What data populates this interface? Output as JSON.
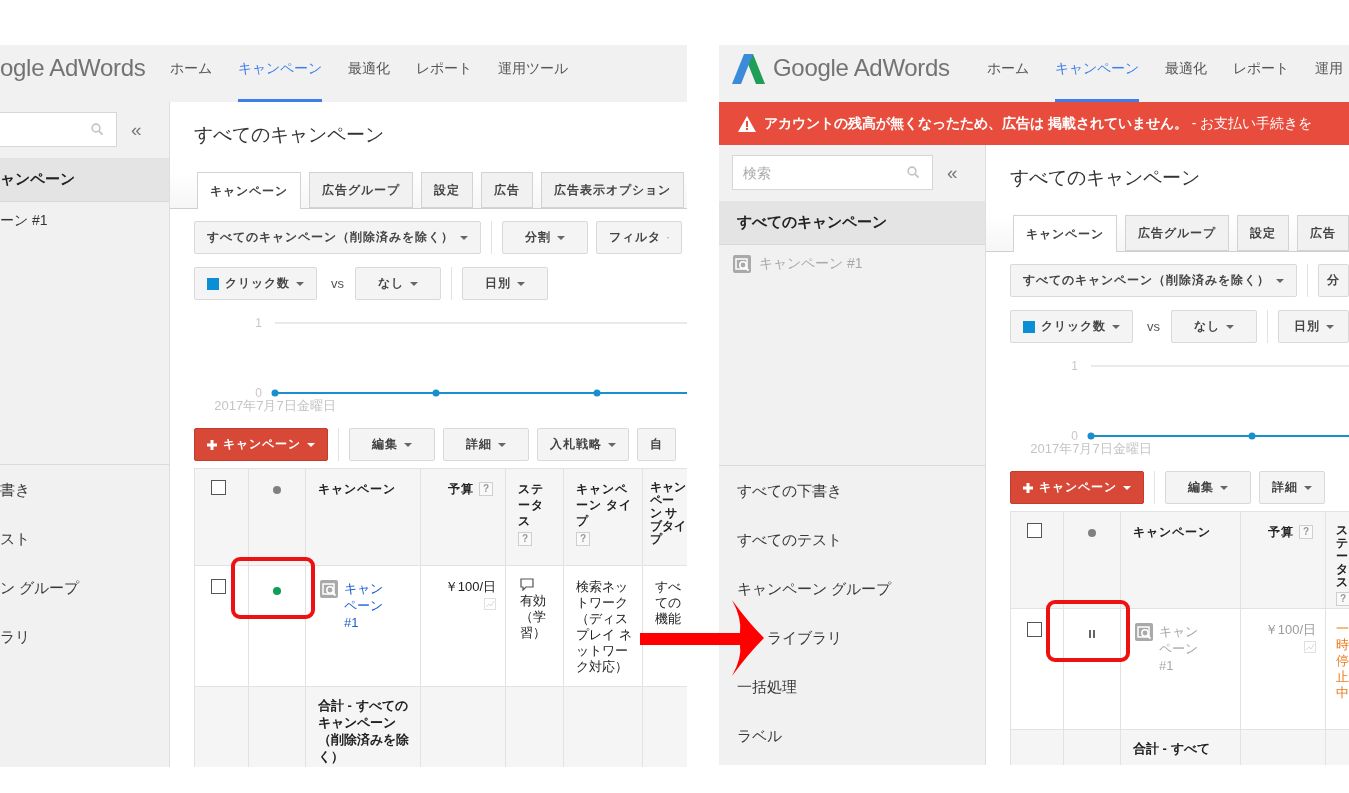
{
  "screens": [
    {
      "header": {
        "logo": "ogle AdWords",
        "nav": [
          {
            "label": "ホーム",
            "selected": false
          },
          {
            "label": "キャンペーン",
            "selected": true
          },
          {
            "label": "最適化",
            "selected": false
          },
          {
            "label": "レポート",
            "selected": false
          },
          {
            "label": "運用ツール",
            "selected": false
          }
        ]
      },
      "sidebar": {
        "collapse": "«",
        "views": [
          {
            "label": "ャンペーン",
            "selected": true
          }
        ],
        "campaigns": [
          {
            "label": "ーン #1",
            "paused": false
          }
        ],
        "links": [
          {
            "label": "書き"
          },
          {
            "label": "スト"
          },
          {
            "label": "ン グループ"
          },
          {
            "label": "ラリ"
          }
        ]
      },
      "main": {
        "title": "すべてのキャンペーン",
        "tabs": [
          {
            "label": "キャンペーン",
            "selected": true
          },
          {
            "label": "広告グループ",
            "selected": false
          },
          {
            "label": "設定",
            "selected": false
          },
          {
            "label": "広告",
            "selected": false
          },
          {
            "label": "広告表示オプション",
            "selected": false
          }
        ],
        "filter_groups": [
          [
            {
              "label": "すべてのキャンペーン（削除済みを除く）",
              "dropdown": true
            }
          ],
          [
            {
              "label": "分割",
              "dropdown": true
            },
            {
              "label": "フィルタ",
              "dropdown": true
            }
          ]
        ],
        "metric_bar": {
          "metric": {
            "label": "クリック数",
            "color": "#0b8fd4"
          },
          "vs": "vs",
          "compare": "なし",
          "period": "日別"
        },
        "trend_chart": {
          "y_labels": [
            "1",
            "0"
          ],
          "date_label": "2017年7月7日金曜日"
        },
        "action_groups": [
          [
            {
              "kind": "primary",
              "label": "キャンペーン",
              "dropdown": true
            }
          ],
          [
            {
              "kind": "default",
              "label": "編集",
              "dropdown": true
            },
            {
              "kind": "default",
              "label": "詳細",
              "dropdown": true
            },
            {
              "kind": "default",
              "label": "入札戦略",
              "dropdown": true
            },
            {
              "kind": "default",
              "label": "自",
              "dropdown": false
            }
          ]
        ],
        "table": {
          "select_all": {
            "checked": false
          },
          "columns": [
            {
              "kind": "campaign",
              "label": "キャンペーン"
            },
            {
              "kind": "budget",
              "label": "予算",
              "help": "?"
            },
            {
              "kind": "status",
              "label": "ステータス",
              "help": "?"
            },
            {
              "kind": "text",
              "label": "キャンペーン タイプ",
              "help": "?"
            },
            {
              "kind": "text",
              "label": "キャンペーン サブタイプ"
            }
          ],
          "rows": [
            {
              "checked": false,
              "paused": false,
              "highlighted": true,
              "cells": [
                "キャンペーン #1",
                "￥100/日",
                "有効（学習）",
                "検索ネットワーク（ディスプレイ ネットワーク対応）",
                "すべての機能"
              ]
            }
          ],
          "total": "合計 - すべてのキャンペーン（削除済みを除く）"
        }
      }
    },
    {
      "header": {
        "logo": "Google AdWords",
        "logo_mark": true,
        "nav": [
          {
            "label": "ホーム",
            "selected": false
          },
          {
            "label": "キャンペーン",
            "selected": true
          },
          {
            "label": "最適化",
            "selected": false
          },
          {
            "label": "レポート",
            "selected": false
          },
          {
            "label": "運用",
            "selected": false
          }
        ]
      },
      "alert": {
        "text": "**アカウントの残高が無くなったため、広告は 掲載されていません。** - お支払い手続きを"
      },
      "sidebar": {
        "search": {
          "placeholder": "検索"
        },
        "collapse": "«",
        "views": [
          {
            "label": "すべてのキャンペーン",
            "selected": true
          }
        ],
        "campaigns": [
          {
            "label": "キャンペーン #1",
            "paused": true,
            "kind": "search"
          }
        ],
        "links": [
          {
            "label": "すべての下書き"
          },
          {
            "label": "すべてのテスト"
          },
          {
            "label": "キャンペーン グループ"
          },
          {
            "label": "ライブラリ",
            "covered": true
          },
          {
            "label": "一括処理"
          },
          {
            "label": "ラベル"
          }
        ]
      },
      "main": {
        "title": "すべてのキャンペーン",
        "tabs": [
          {
            "label": "キャンペーン",
            "selected": true
          },
          {
            "label": "広告グループ",
            "selected": false
          },
          {
            "label": "設定",
            "selected": false
          },
          {
            "label": "広告",
            "selected": false
          }
        ],
        "filter_groups": [
          [
            {
              "label": "すべてのキャンペーン（削除済みを除く）",
              "dropdown": true
            }
          ],
          [
            {
              "label": "分",
              "dropdown": false
            }
          ]
        ],
        "metric_bar": {
          "metric": {
            "label": "クリック数",
            "color": "#0b8fd4"
          },
          "vs": "vs",
          "compare": "なし",
          "period": "日別"
        },
        "trend_chart": {
          "y_labels": [
            "1",
            "0"
          ],
          "date_label": "2017年7月7日金曜日"
        },
        "action_groups": [
          [
            {
              "kind": "primary",
              "label": "キャンペーン",
              "dropdown": true
            }
          ],
          [
            {
              "kind": "default",
              "label": "編集",
              "dropdown": true
            },
            {
              "kind": "default",
              "label": "詳細",
              "dropdown": true
            }
          ]
        ],
        "table": {
          "select_all": {
            "checked": false
          },
          "columns": [
            {
              "kind": "campaign",
              "label": "キャンペーン"
            },
            {
              "kind": "budget",
              "label": "予算",
              "help": "?"
            },
            {
              "kind": "status",
              "label": "ステータス",
              "help": "?"
            }
          ],
          "rows": [
            {
              "checked": false,
              "paused": true,
              "highlighted": true,
              "cells": [
                "キャンペーン #1",
                "￥100/日",
                "一時停止中"
              ]
            }
          ],
          "total": "合計 - すべて"
        }
      }
    }
  ],
  "transition_arrow": true
}
